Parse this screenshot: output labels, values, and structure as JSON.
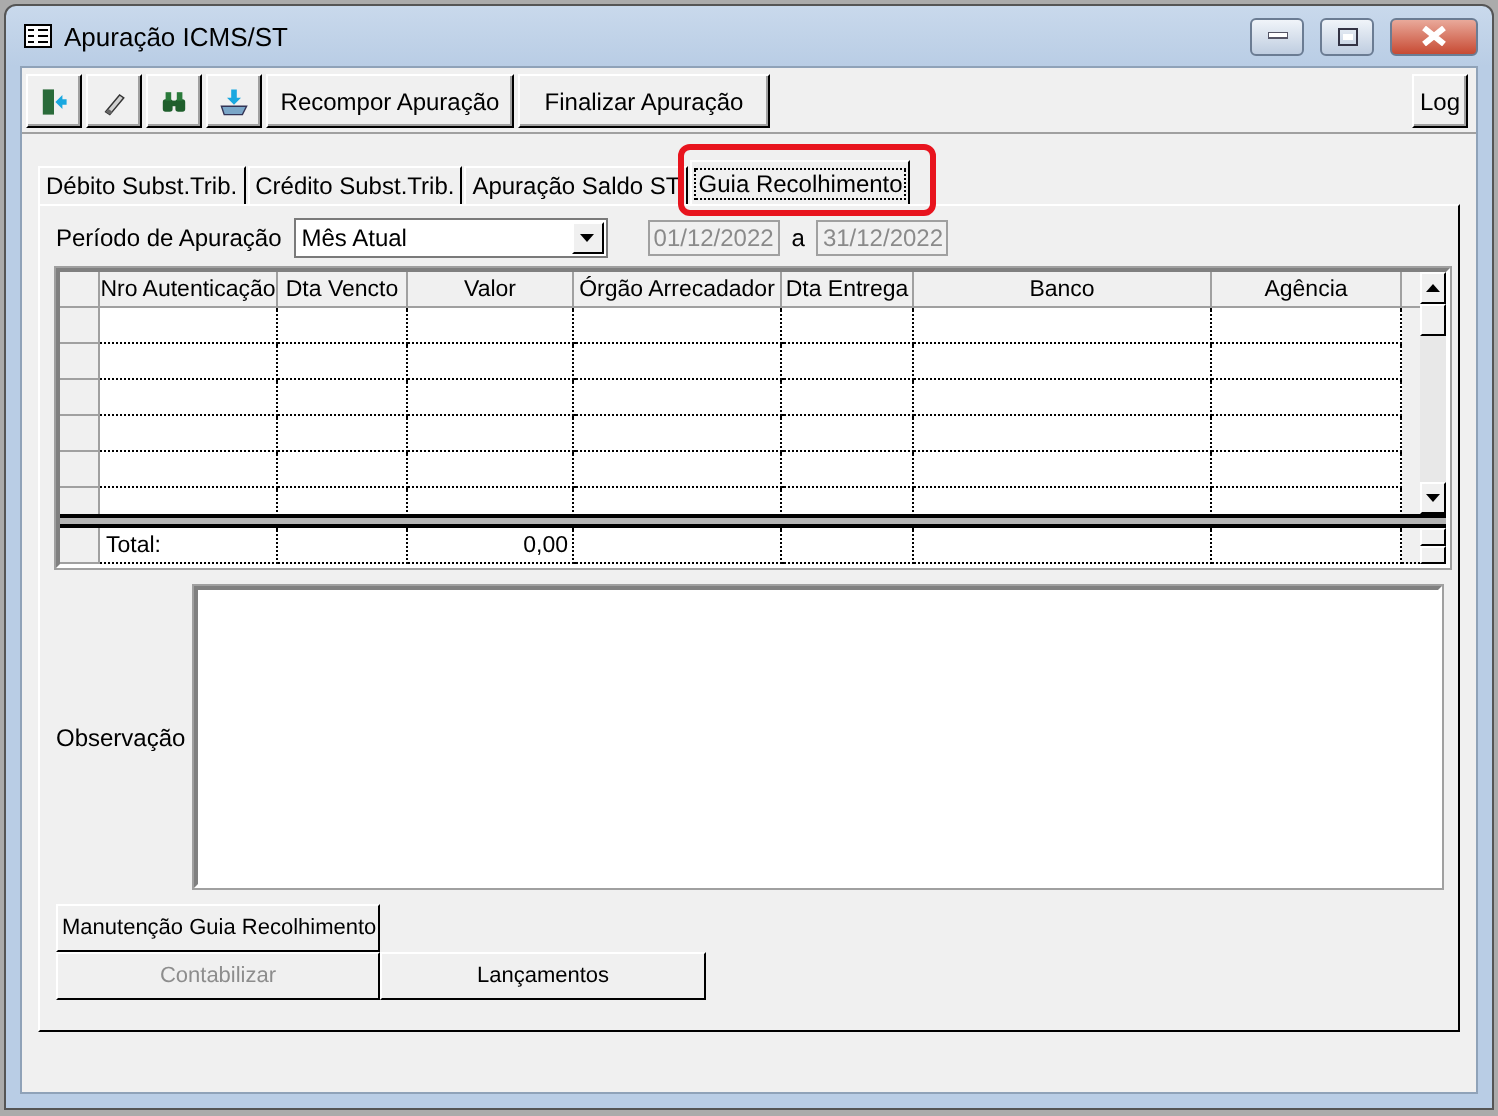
{
  "window": {
    "title": "Apuração ICMS/ST"
  },
  "toolbar": {
    "icon_buttons": [
      {
        "kind": "exit"
      },
      {
        "kind": "eraser"
      },
      {
        "kind": "binoculars"
      },
      {
        "kind": "import"
      }
    ],
    "buttons": [
      "Recompor Apuração",
      "Finalizar Apuração"
    ],
    "log_button": "Log"
  },
  "tabs": [
    {
      "label": "Débito Subst.Trib.",
      "selected": false,
      "highlighted": false
    },
    {
      "label": "Crédito Subst.Trib.",
      "selected": false,
      "highlighted": false
    },
    {
      "label": "Apuração Saldo ST",
      "selected": false,
      "highlighted": false
    },
    {
      "label": "Guia Recolhimento",
      "selected": true,
      "highlighted": true
    }
  ],
  "period": {
    "label": "Período de  Apuração",
    "value": "Mês Atual",
    "from": "01/12/2022",
    "separator": "a",
    "to": "31/12/2022"
  },
  "table": {
    "columns": [
      "Nro Autenticação",
      "Dta Vencto",
      "Valor",
      "Órgão Arrecadador",
      "Dta Entrega",
      "Banco",
      "Agência"
    ],
    "total_row": {
      "label": "Total:",
      "value": "0,00"
    }
  },
  "observation": {
    "label": "Observação"
  },
  "buttons": [
    {
      "label": "Manutenção Guia Recolhimento",
      "disabled": false
    },
    {
      "label": "Contabilizar",
      "disabled": true
    },
    {
      "label": "Lançamentos",
      "disabled": false
    }
  ]
}
